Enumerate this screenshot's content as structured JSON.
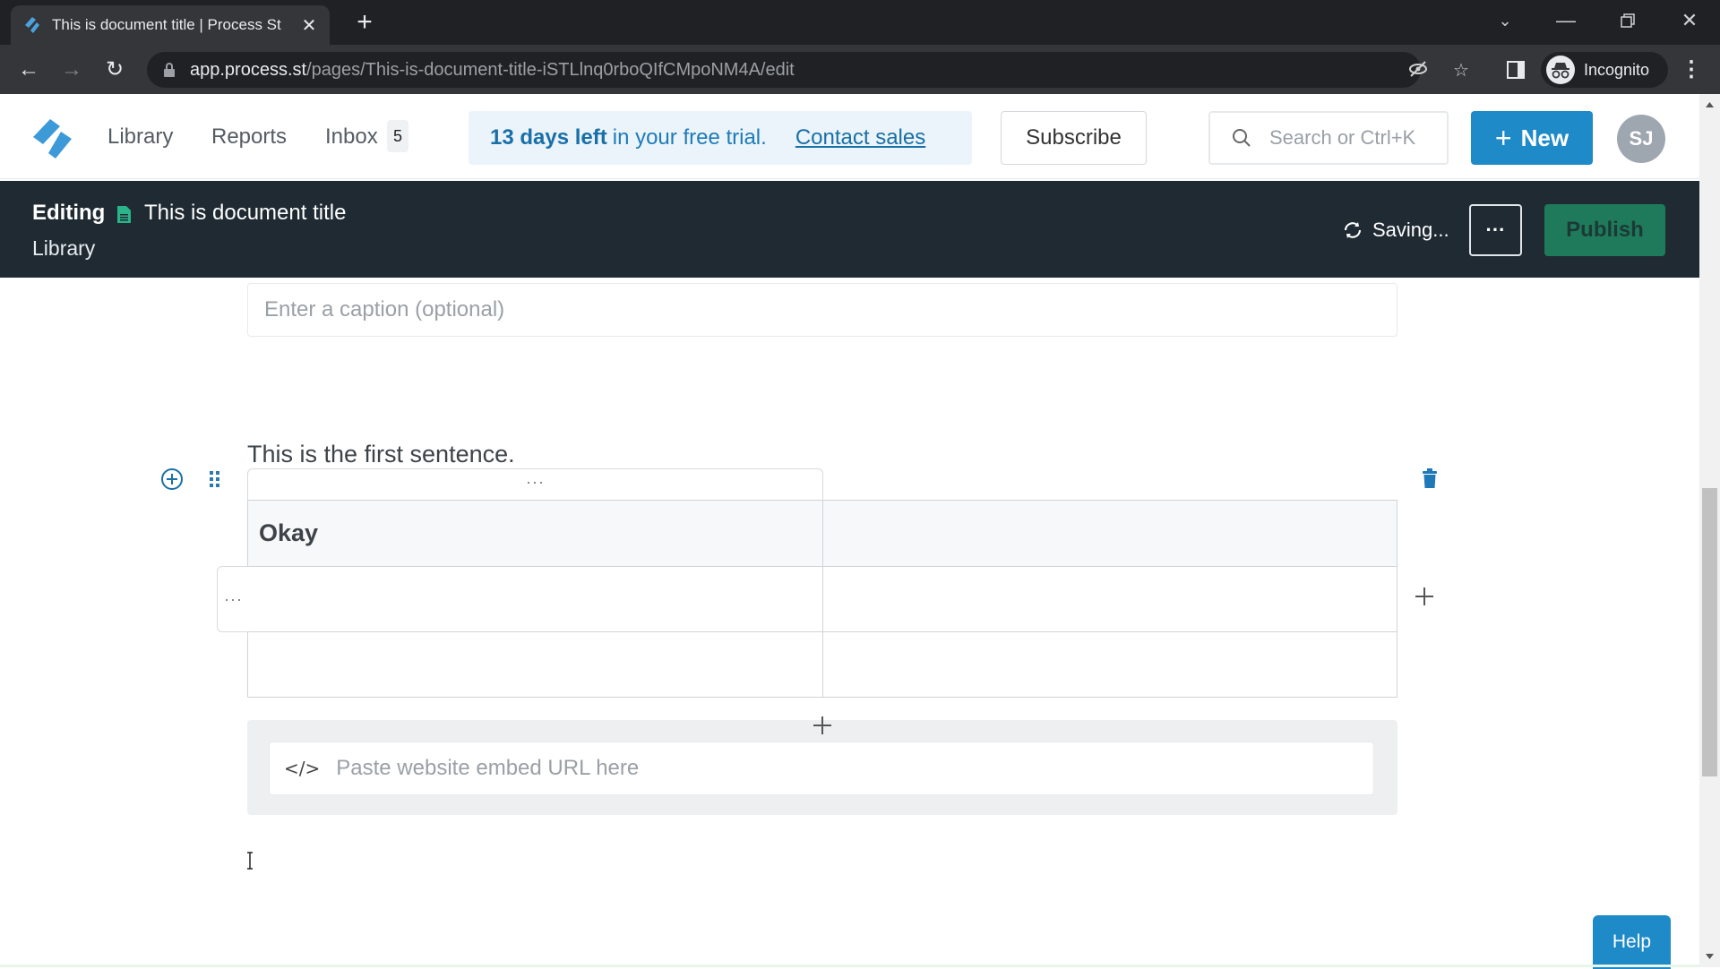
{
  "browser": {
    "tab_title": "This is document title | Process St",
    "url_host": "app.process.st",
    "url_path": "/pages/This-is-document-title-iSTLlnq0rboQIfCMpoNM4A/edit",
    "profile_label": "Incognito",
    "icons": {
      "back": "arrow-left-icon",
      "forward": "arrow-right-icon",
      "reload": "reload-icon",
      "lock": "lock-icon",
      "tracking": "eye-slash-icon",
      "bookmark": "star-icon",
      "sidepanel": "side-panel-icon",
      "menu": "kebab-menu-icon"
    }
  },
  "app_header": {
    "nav": [
      {
        "label": "Library"
      },
      {
        "label": "Reports"
      },
      {
        "label": "Inbox"
      }
    ],
    "inbox_count": "5",
    "trial": {
      "bold": "13 days left",
      "rest": "in your free trial.",
      "link": "Contact sales"
    },
    "subscribe_label": "Subscribe",
    "search_placeholder": "Search or Ctrl+K",
    "new_label": "New",
    "user_initials": "SJ",
    "accent_color": "#1f8ac8"
  },
  "editor_bar": {
    "mode_label": "Editing",
    "doc_title": "This is document title",
    "breadcrumb": "Library",
    "status": "Saving...",
    "more_label": "···",
    "publish_label": "Publish"
  },
  "content": {
    "caption_placeholder": "Enter a caption (optional)",
    "sentence": "This is the first sentence.",
    "column_handle": "···",
    "row_handle": "···",
    "table": {
      "rows": [
        [
          "Okay",
          ""
        ],
        [
          "",
          ""
        ],
        [
          "",
          ""
        ]
      ]
    },
    "embed_placeholder": "Paste website embed URL here",
    "embed_icon": "</>"
  },
  "help_label": "Help"
}
